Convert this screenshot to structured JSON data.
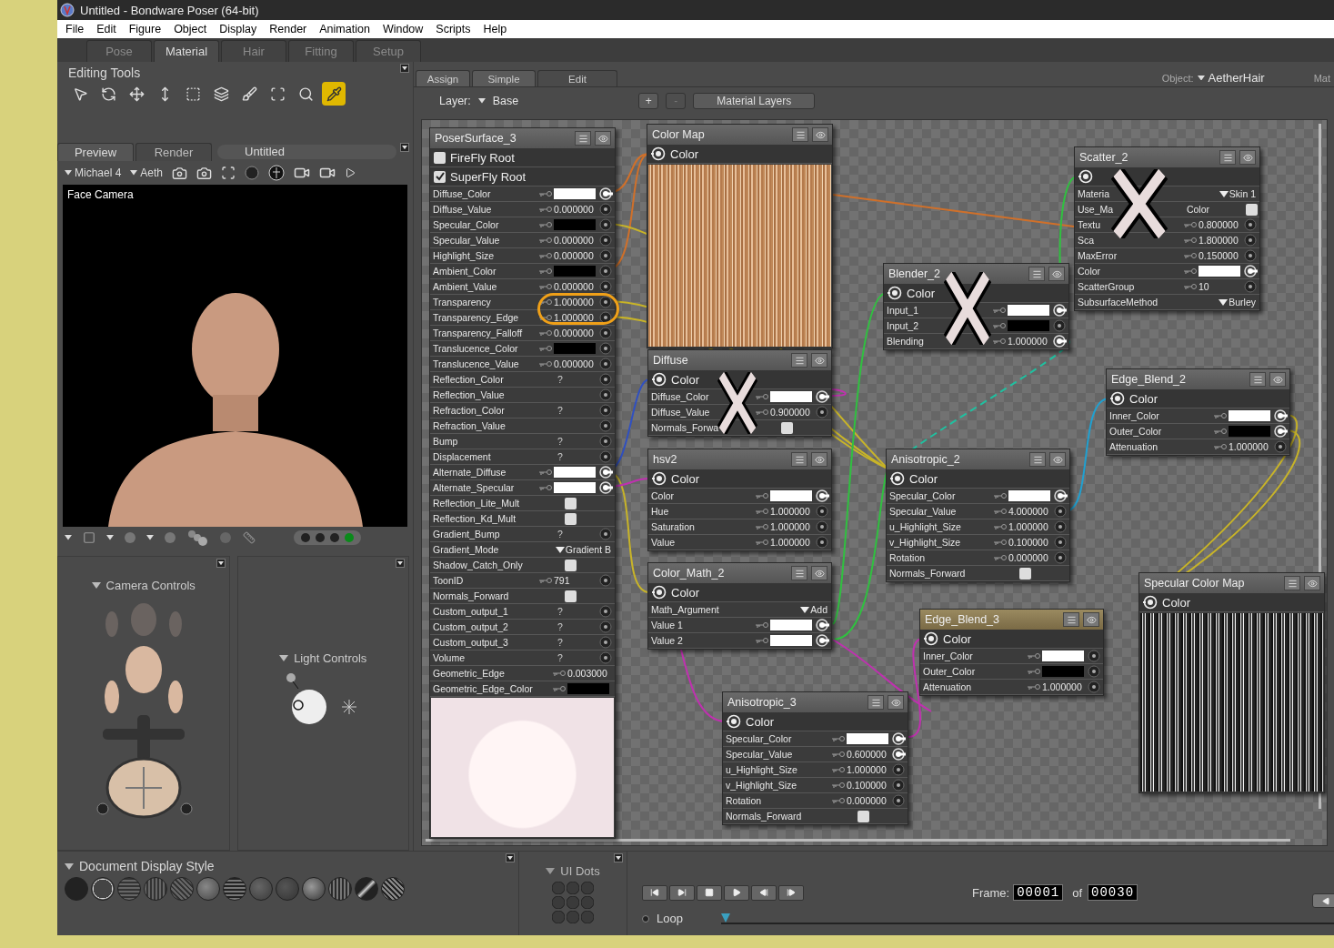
{
  "window": {
    "title": "Untitled - Bondware Poser (64-bit)"
  },
  "menu": [
    "File",
    "Edit",
    "Figure",
    "Object",
    "Display",
    "Render",
    "Animation",
    "Window",
    "Scripts",
    "Help"
  ],
  "room_tabs": [
    {
      "label": "Pose",
      "selected": false
    },
    {
      "label": "Material",
      "selected": true
    },
    {
      "label": "Hair",
      "selected": false
    },
    {
      "label": "Fitting",
      "selected": false
    },
    {
      "label": "Setup",
      "selected": false
    }
  ],
  "editing_tools": {
    "title": "Editing Tools",
    "tools": [
      {
        "selected": false
      },
      {
        "selected": false
      },
      {
        "selected": false
      },
      {
        "selected": false
      },
      {
        "selected": false
      },
      {
        "selected": false
      },
      {
        "selected": false
      },
      {
        "selected": false
      },
      {
        "selected": false
      },
      {
        "selected": true
      }
    ]
  },
  "preview": {
    "tabs": [
      {
        "label": "Preview",
        "selected": true
      },
      {
        "label": "Render",
        "selected": false
      }
    ],
    "document_title": "Untitled",
    "figure": "Michael 4",
    "prop": "Aeth",
    "camera_label": "Face Camera"
  },
  "camera_controls": {
    "title": "Camera Controls"
  },
  "light_controls": {
    "title": "Light Controls"
  },
  "document_display_style": {
    "title": "Document Display Style"
  },
  "ui_dots": {
    "title": "UI Dots"
  },
  "material_tabs": [
    {
      "label": "Assign",
      "selected": false
    },
    {
      "label": "Simple",
      "selected": false
    },
    {
      "label": "Edit",
      "selected": true
    }
  ],
  "layer": {
    "label": "Layer:",
    "value": "Base",
    "add": "+",
    "remove": "-",
    "layers_button": "Material Layers"
  },
  "object": {
    "label": "Object:",
    "value": "AetherHair",
    "next_label": "Mat"
  },
  "nodes": [
    {
      "title": "PoserSurface_3",
      "kind": "shader",
      "selected": false,
      "crossed": false,
      "preview": true,
      "roots": [
        {
          "label": "FireFly Root",
          "checked": false
        },
        {
          "label": "SuperFly Root",
          "checked": true
        }
      ],
      "rows": [
        {
          "label": "Diffuse_Color",
          "kind": "color",
          "color": "#ffffff",
          "linked": true
        },
        {
          "label": "Diffuse_Value",
          "kind": "value",
          "value": "0.000000",
          "linked": false
        },
        {
          "label": "Specular_Color",
          "kind": "color",
          "color": "#000000",
          "linked": false
        },
        {
          "label": "Specular_Value",
          "kind": "value",
          "value": "0.000000",
          "linked": false
        },
        {
          "label": "Highlight_Size",
          "kind": "value",
          "value": "0.000000",
          "linked": false
        },
        {
          "label": "Ambient_Color",
          "kind": "color",
          "color": "#000000",
          "linked": false
        },
        {
          "label": "Ambient_Value",
          "kind": "value",
          "value": "0.000000",
          "linked": false
        },
        {
          "label": "Transparency",
          "kind": "value",
          "value": "1.000000",
          "linked": false
        },
        {
          "label": "Transparency_Edge",
          "kind": "value",
          "value": "1.000000",
          "linked": false
        },
        {
          "label": "Transparency_Falloff",
          "kind": "value",
          "value": "0.000000",
          "linked": false
        },
        {
          "label": "Translucence_Color",
          "kind": "color",
          "color": "#000000",
          "linked": false
        },
        {
          "label": "Translucence_Value",
          "kind": "value",
          "value": "0.000000",
          "linked": false
        },
        {
          "label": "Reflection_Color",
          "kind": "unknown",
          "value": "?",
          "linked": false
        },
        {
          "label": "Reflection_Value",
          "kind": "plain",
          "linked": false
        },
        {
          "label": "Refraction_Color",
          "kind": "unknown",
          "value": "?",
          "linked": false
        },
        {
          "label": "Refraction_Value",
          "kind": "plain",
          "linked": false
        },
        {
          "label": "Bump",
          "kind": "unknown",
          "value": "?",
          "linked": false
        },
        {
          "label": "Displacement",
          "kind": "unknown",
          "value": "?",
          "linked": false
        },
        {
          "label": "Alternate_Diffuse",
          "kind": "color",
          "color": "#ffffff",
          "linked": true
        },
        {
          "label": "Alternate_Specular",
          "kind": "color",
          "color": "#ffffff",
          "linked": true
        },
        {
          "label": "Reflection_Lite_Mult",
          "kind": "check",
          "checked": false
        },
        {
          "label": "Reflection_Kd_Mult",
          "kind": "check",
          "checked": false
        },
        {
          "label": "Gradient_Bump",
          "kind": "unknown",
          "value": "?",
          "linked": false
        },
        {
          "label": "Gradient_Mode",
          "kind": "menu",
          "value": "Gradient B"
        },
        {
          "label": "Shadow_Catch_Only",
          "kind": "check",
          "checked": false
        },
        {
          "label": "ToonID",
          "kind": "value",
          "value": "791",
          "linked": false
        },
        {
          "label": "Normals_Forward",
          "kind": "check",
          "checked": false
        },
        {
          "label": "Custom_output_1",
          "kind": "unknown",
          "value": "?",
          "linked": false
        },
        {
          "label": "Custom_output_2",
          "kind": "unknown",
          "value": "?",
          "linked": false
        },
        {
          "label": "Custom_output_3",
          "kind": "unknown",
          "value": "?",
          "linked": false
        },
        {
          "label": "Volume",
          "kind": "unknown",
          "value": "?",
          "linked": false
        },
        {
          "label": "Geometric_Edge",
          "kind": "value",
          "value": "0.003000"
        },
        {
          "label": "Geometric_Edge_Color",
          "kind": "color",
          "color": "#000000"
        }
      ]
    },
    {
      "title": "Color Map",
      "kind": "image",
      "selected": false,
      "crossed": false,
      "output": "Color"
    },
    {
      "title": "Scatter_2",
      "kind": "shader",
      "selected": false,
      "crossed": true,
      "rows": [
        {
          "label": "Materia",
          "kind": "menu",
          "value": "Skin 1"
        },
        {
          "label": "Use_Ma",
          "tail": "Color",
          "kind": "check",
          "checked": false
        },
        {
          "label": "Textu",
          "kind": "value",
          "value": "0.800000",
          "linked": false
        },
        {
          "label": "Sca",
          "kind": "value",
          "value": "1.800000",
          "linked": false
        },
        {
          "label": "MaxError",
          "kind": "value",
          "value": "0.150000",
          "linked": false
        },
        {
          "label": "Color",
          "kind": "color",
          "color": "#ffffff",
          "linked": true
        },
        {
          "label": "ScatterGroup",
          "kind": "value",
          "value": "10",
          "linked": false
        },
        {
          "label": "SubsurfaceMethod",
          "kind": "menu",
          "value": "Burley"
        }
      ]
    },
    {
      "title": "Blender_2",
      "kind": "shader",
      "selected": false,
      "crossed": true,
      "output": "Color",
      "rows": [
        {
          "label": "Input_1",
          "kind": "color",
          "color": "#ffffff",
          "linked": true
        },
        {
          "label": "Input_2",
          "kind": "color",
          "color": "#000000",
          "linked": false
        },
        {
          "label": "Blending",
          "kind": "value",
          "value": "1.000000",
          "linked": true
        }
      ]
    },
    {
      "title": "Diffuse",
      "kind": "shader",
      "selected": false,
      "crossed": true,
      "output": "Color",
      "rows": [
        {
          "label": "Diffuse_Color",
          "kind": "color",
          "color": "#ffffff",
          "linked": true
        },
        {
          "label": "Diffuse_Value",
          "kind": "value",
          "value": "0.900000",
          "linked": false
        },
        {
          "label": "Normals_Forwa",
          "kind": "check",
          "checked": false
        }
      ]
    },
    {
      "title": "hsv2",
      "kind": "shader",
      "selected": false,
      "crossed": false,
      "output": "Color",
      "rows": [
        {
          "label": "Color",
          "kind": "color",
          "color": "#ffffff",
          "linked": true
        },
        {
          "label": "Hue",
          "kind": "value",
          "value": "1.000000",
          "linked": false
        },
        {
          "label": "Saturation",
          "kind": "value",
          "value": "1.000000",
          "linked": false
        },
        {
          "label": "Value",
          "kind": "value",
          "value": "1.000000",
          "linked": false
        }
      ]
    },
    {
      "title": "Anisotropic_2",
      "kind": "shader",
      "selected": false,
      "crossed": false,
      "output": "Color",
      "rows": [
        {
          "label": "Specular_Color",
          "kind": "color",
          "color": "#ffffff",
          "linked": true
        },
        {
          "label": "Specular_Value",
          "kind": "value",
          "value": "4.000000",
          "linked": false
        },
        {
          "label": "u_Highlight_Size",
          "kind": "value",
          "value": "1.000000",
          "linked": false
        },
        {
          "label": "v_Highlight_Size",
          "kind": "value",
          "value": "0.100000",
          "linked": false
        },
        {
          "label": "Rotation",
          "kind": "value",
          "value": "0.000000",
          "linked": false
        },
        {
          "label": "Normals_Forward",
          "kind": "check",
          "checked": false
        }
      ]
    },
    {
      "title": "Edge_Blend_2",
      "kind": "shader",
      "selected": false,
      "crossed": false,
      "output": "Color",
      "rows": [
        {
          "label": "Inner_Color",
          "kind": "color",
          "color": "#ffffff",
          "linked": true
        },
        {
          "label": "Outer_Color",
          "kind": "color",
          "color": "#000000",
          "linked": true
        },
        {
          "label": "Attenuation",
          "kind": "value",
          "value": "1.000000",
          "linked": false
        }
      ]
    },
    {
      "title": "Color_Math_2",
      "kind": "shader",
      "selected": false,
      "crossed": false,
      "output": "Color",
      "rows": [
        {
          "label": "Math_Argument",
          "kind": "menu",
          "value": "Add"
        },
        {
          "label": "Value 1",
          "kind": "color",
          "color": "#ffffff",
          "linked": true
        },
        {
          "label": "Value 2",
          "kind": "color",
          "color": "#ffffff",
          "linked": true
        }
      ]
    },
    {
      "title": "Edge_Blend_3",
      "kind": "shader",
      "selected": true,
      "crossed": false,
      "output": "Color",
      "rows": [
        {
          "label": "Inner_Color",
          "kind": "color",
          "color": "#ffffff",
          "linked": false
        },
        {
          "label": "Outer_Color",
          "kind": "color",
          "color": "#000000",
          "linked": false
        },
        {
          "label": "Attenuation",
          "kind": "value",
          "value": "1.000000",
          "linked": false
        }
      ]
    },
    {
      "title": "Specular Color Map",
      "kind": "image",
      "selected": false,
      "crossed": false,
      "output": "Color"
    },
    {
      "title": "Anisotropic_3",
      "kind": "shader",
      "selected": false,
      "crossed": false,
      "output": "Color",
      "rows": [
        {
          "label": "Specular_Color",
          "kind": "color",
          "color": "#ffffff",
          "linked": true
        },
        {
          "label": "Specular_Value",
          "kind": "value",
          "value": "0.600000",
          "linked": true
        },
        {
          "label": "u_Highlight_Size",
          "kind": "value",
          "value": "1.000000",
          "linked": false
        },
        {
          "label": "v_Highlight_Size",
          "kind": "value",
          "value": "0.100000",
          "linked": false
        },
        {
          "label": "Rotation",
          "kind": "value",
          "value": "0.000000",
          "linked": false
        },
        {
          "label": "Normals_Forward",
          "kind": "check",
          "checked": false
        }
      ]
    }
  ],
  "timeline": {
    "frame_label": "Frame:",
    "frame": "00001",
    "of_label": "of",
    "total": "00030",
    "loop": "Loop",
    "loop_on": false,
    "level": 0
  }
}
